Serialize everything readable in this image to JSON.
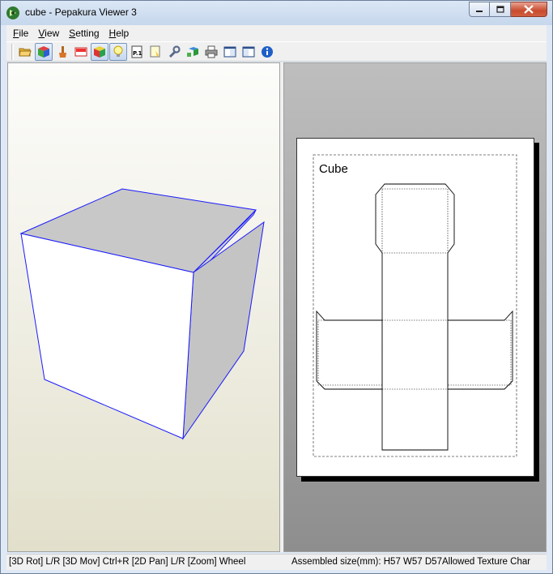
{
  "window": {
    "title": "cube - Pepakura Viewer 3",
    "app_icon": "pepakura-logo-icon",
    "controls": [
      "minimize-icon",
      "maximize-icon",
      "close-icon"
    ]
  },
  "menu": {
    "items": [
      {
        "label": "File",
        "accel": "F"
      },
      {
        "label": "View",
        "accel": "V"
      },
      {
        "label": "Setting",
        "accel": "S"
      },
      {
        "label": "Help",
        "accel": "H"
      }
    ]
  },
  "toolbar": {
    "buttons": [
      {
        "icon": "open-folder-icon",
        "active": false
      },
      {
        "icon": "3d-texture-cube-icon",
        "active": true
      },
      {
        "icon": "brush-icon",
        "active": false
      },
      {
        "icon": "numbered-edges-icon",
        "active": false
      },
      {
        "icon": "colored-cube-icon",
        "active": true
      },
      {
        "icon": "light-bulb-icon",
        "active": true
      },
      {
        "icon": "page-p1-icon",
        "active": false
      },
      {
        "icon": "sticky-note-icon",
        "active": false
      },
      {
        "icon": "wrench-icon",
        "active": false
      },
      {
        "icon": "unfold-cube-icon",
        "active": false
      },
      {
        "icon": "printer-icon",
        "active": false
      },
      {
        "icon": "window-layout-left-icon",
        "active": false
      },
      {
        "icon": "window-layout-right-icon",
        "active": false
      },
      {
        "icon": "info-icon",
        "active": false
      }
    ],
    "p1_label": "P.1"
  },
  "view3d": {
    "edge_color": "#1a1aff",
    "face_colors": [
      "#ffffff",
      "#c8c8c8",
      "#c0c0c0"
    ]
  },
  "view2d": {
    "part_title": "Cube"
  },
  "status": {
    "left": "[3D Rot] L/R [3D Mov] Ctrl+R [2D Pan] L/R [Zoom] Wheel",
    "right": "Assembled size(mm): H57 W57 D57Allowed Texture Char"
  },
  "colors": {
    "titlebar": "#c6d7ec",
    "close_button": "#c94b2c",
    "chrome": "#f0f0f0"
  }
}
